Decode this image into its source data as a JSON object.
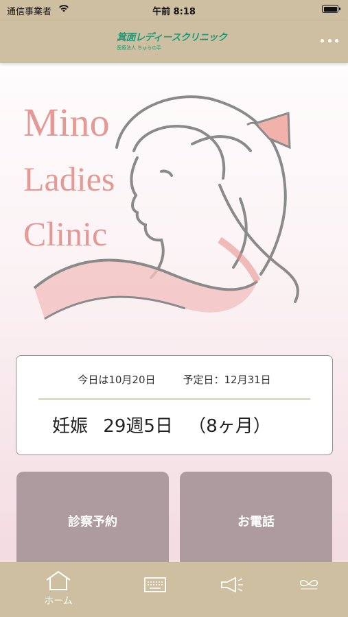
{
  "status_bar": {
    "carrier": "通信事業者",
    "time": "午前 8:18"
  },
  "nav": {
    "logo_title": "箕面レディースクリニック",
    "logo_subtitle": "医療法人 ちゅらの手"
  },
  "hero": {
    "line1": "Mino",
    "line2": "Ladies",
    "line3": "Clinic"
  },
  "info": {
    "today": "今日は10月20日",
    "due": "予定日：12月31日",
    "status": "妊娠",
    "weeks": "29週5日",
    "months": "（8ヶ月）"
  },
  "tiles": {
    "reserve": "診察予約",
    "phone": "お電話"
  },
  "tabs": {
    "home": "ホーム"
  },
  "colors": {
    "bar": "#cdbf9f",
    "accent_pink": "#e8958e",
    "tile": "#ad9b9f",
    "logo_green": "#1a9a7a"
  }
}
